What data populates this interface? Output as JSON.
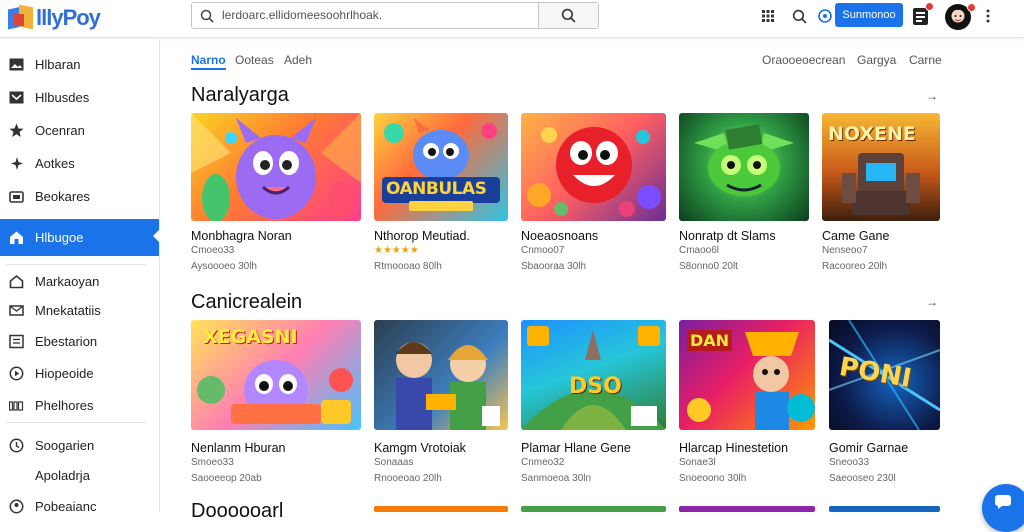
{
  "app": {
    "logo_text": "lllyPoy"
  },
  "search": {
    "query": "lerdoarc.ellidomeesoohrlhoak."
  },
  "header": {
    "signin_label": "Sunmonoo"
  },
  "sidebar": {
    "items": [
      {
        "label": "Hlbaran"
      },
      {
        "label": "Hlbusdes"
      },
      {
        "label": "Ocenran"
      },
      {
        "label": "Aotkes"
      },
      {
        "label": "Beokares"
      },
      {
        "label": "Hlbugoe"
      },
      {
        "label": "Markaoyan"
      },
      {
        "label": "Mnekatatiis"
      },
      {
        "label": "Ebestarion"
      },
      {
        "label": "Hiopeoide"
      },
      {
        "label": "Phelhores"
      },
      {
        "label": "Soogarien"
      },
      {
        "label": "Apoladrja"
      },
      {
        "label": "Pobeaianc"
      }
    ]
  },
  "tabs": [
    {
      "label": "Narno"
    },
    {
      "label": "Ooteas"
    },
    {
      "label": "Adeh"
    }
  ],
  "right_tabs": [
    {
      "label": "Oraooeoecrean"
    },
    {
      "label": "Gargya"
    },
    {
      "label": "Carne"
    }
  ],
  "sections": [
    {
      "title": "Naralyarga",
      "arrow": "→",
      "cards": [
        {
          "title": "Monbhagra Noran",
          "sub": "Cmoeo33",
          "meta": "Aysoooeo 30lh",
          "art": ""
        },
        {
          "title": "Nthorop Meutiad.",
          "sub": "★★★★★",
          "meta": "Rtmoooao 80lh",
          "art": "OANBULAS"
        },
        {
          "title": "Noeaosnoans",
          "sub": "Cnmoo07",
          "meta": "Sbaooraa 30lh",
          "art": ""
        },
        {
          "title": "Nonratp dt Slams",
          "sub": "Cmaoo6l",
          "meta": "S8onno0 20lt",
          "art": ""
        },
        {
          "title": "Came Gane",
          "sub": "Nenseoo7",
          "meta": "Racooreo 20lh",
          "art": "NOXENE"
        }
      ]
    },
    {
      "title": "Canicrealein",
      "arrow": "→",
      "cards": [
        {
          "title": "Nenlanm Hburan",
          "sub": "Smoeo33",
          "meta": "Saooeeop 20ab",
          "art": "XEGASNI"
        },
        {
          "title": "Kamgm Vrotoiak",
          "sub": "Sonaaas",
          "meta": "Rnooeoao 20lh",
          "art": ""
        },
        {
          "title": "Plamar Hlane Gene",
          "sub": "Cnmeo32",
          "meta": "Sanmoeoa 30ln",
          "art": "DSO"
        },
        {
          "title": "Hlarcap Hinestetion",
          "sub": "Sonae3l",
          "meta": "Snoeoono 30lh",
          "art": "DAN"
        },
        {
          "title": "Gomir Garnae",
          "sub": "Sneoo33",
          "meta": "Saeooseo 230l",
          "art": "PONI"
        }
      ]
    }
  ],
  "third_section": {
    "title": "Doooooarl"
  },
  "colors": {
    "accent": "#1a73e8",
    "signin": "#1a73e8"
  }
}
